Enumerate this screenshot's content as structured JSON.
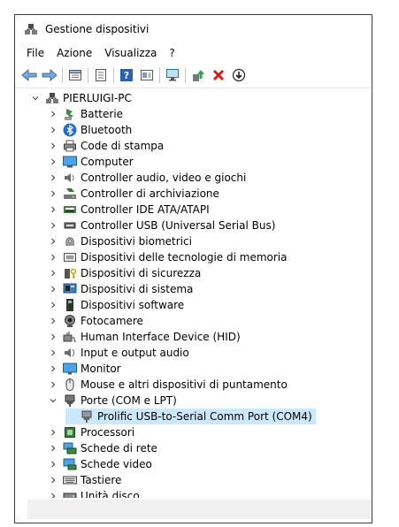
{
  "window": {
    "title": "Gestione dispositivi"
  },
  "menu": [
    "File",
    "Azione",
    "Visualizza",
    "?"
  ],
  "toolbar": [
    {
      "name": "back-icon"
    },
    {
      "name": "forward-icon"
    },
    {
      "sep": true
    },
    {
      "name": "properties-icon"
    },
    {
      "sep": true
    },
    {
      "name": "details-icon"
    },
    {
      "sep": true
    },
    {
      "name": "help-icon"
    },
    {
      "name": "view-icon"
    },
    {
      "sep": true
    },
    {
      "name": "scan-hardware-icon"
    },
    {
      "sep": true
    },
    {
      "name": "update-driver-icon"
    },
    {
      "name": "uninstall-icon"
    },
    {
      "name": "disable-icon"
    }
  ],
  "tree": {
    "root": "PIERLUIGI-PC",
    "categories": [
      {
        "label": "Batterie",
        "icon": "battery-icon"
      },
      {
        "label": "Bluetooth",
        "icon": "bluetooth-icon"
      },
      {
        "label": "Code di stampa",
        "icon": "printer-icon"
      },
      {
        "label": "Computer",
        "icon": "computer-icon"
      },
      {
        "label": "Controller audio, video e giochi",
        "icon": "speaker-icon"
      },
      {
        "label": "Controller di archiviazione",
        "icon": "storage-icon"
      },
      {
        "label": "Controller IDE ATA/ATAPI",
        "icon": "ide-icon"
      },
      {
        "label": "Controller USB (Universal Serial Bus)",
        "icon": "usb-icon"
      },
      {
        "label": "Dispositivi biometrici",
        "icon": "fingerprint-icon"
      },
      {
        "label": "Dispositivi delle tecnologie di memoria",
        "icon": "memory-icon"
      },
      {
        "label": "Dispositivi di sicurezza",
        "icon": "security-icon"
      },
      {
        "label": "Dispositivi di sistema",
        "icon": "system-icon"
      },
      {
        "label": "Dispositivi software",
        "icon": "software-icon"
      },
      {
        "label": "Fotocamere",
        "icon": "camera-icon"
      },
      {
        "label": "Human Interface Device (HID)",
        "icon": "hid-icon"
      },
      {
        "label": "Input e output audio",
        "icon": "audio-io-icon"
      },
      {
        "label": "Monitor",
        "icon": "monitor-icon"
      },
      {
        "label": "Mouse e altri dispositivi di puntamento",
        "icon": "mouse-icon"
      },
      {
        "label": "Porte (COM e LPT)",
        "icon": "port-icon",
        "expanded": true,
        "children": [
          {
            "label": "Prolific USB-to-Serial Comm Port (COM4)",
            "icon": "serial-port-icon",
            "selected": true
          }
        ]
      },
      {
        "label": "Processori",
        "icon": "processor-icon"
      },
      {
        "label": "Schede di rete",
        "icon": "network-icon"
      },
      {
        "label": "Schede video",
        "icon": "display-adapter-icon"
      },
      {
        "label": "Tastiere",
        "icon": "keyboard-icon"
      },
      {
        "label": "Unità disco",
        "icon": "disk-icon"
      }
    ]
  },
  "colors": {
    "selection": "#cce8ff",
    "accent": "#0078d7"
  }
}
